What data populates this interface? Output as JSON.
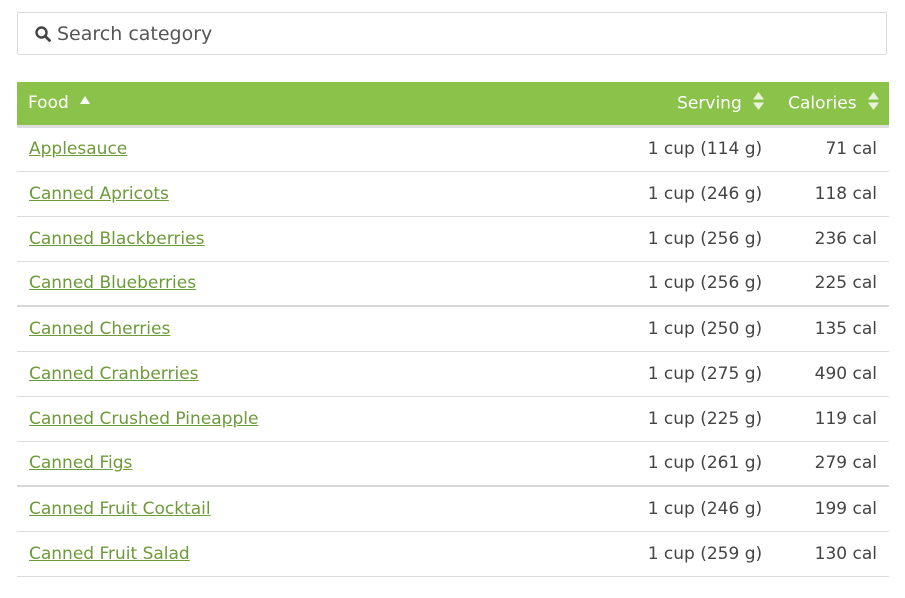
{
  "search": {
    "placeholder": "Search category",
    "value": "",
    "icon": "search-icon"
  },
  "table": {
    "headers": {
      "food": {
        "label": "Food",
        "sort": "ascending"
      },
      "serving": {
        "label": "Serving",
        "sort": "none"
      },
      "calories": {
        "label": "Calories",
        "sort": "none"
      }
    },
    "rows": [
      {
        "food": "Applesauce",
        "serving": "1 cup (114 g)",
        "calories": "71 cal"
      },
      {
        "food": "Canned Apricots",
        "serving": "1 cup (246 g)",
        "calories": "118 cal"
      },
      {
        "food": "Canned Blackberries",
        "serving": "1 cup (256 g)",
        "calories": "236 cal"
      },
      {
        "food": "Canned Blueberries",
        "serving": "1 cup (256 g)",
        "calories": "225 cal"
      },
      {
        "food": "Canned Cherries",
        "serving": "1 cup (250 g)",
        "calories": "135 cal"
      },
      {
        "food": "Canned Cranberries",
        "serving": "1 cup (275 g)",
        "calories": "490 cal"
      },
      {
        "food": "Canned Crushed Pineapple",
        "serving": "1 cup (225 g)",
        "calories": "119 cal"
      },
      {
        "food": "Canned Figs",
        "serving": "1 cup (261 g)",
        "calories": "279 cal"
      },
      {
        "food": "Canned Fruit Cocktail",
        "serving": "1 cup (246 g)",
        "calories": "199 cal"
      },
      {
        "food": "Canned Fruit Salad",
        "serving": "1 cup (259 g)",
        "calories": "130 cal"
      }
    ]
  },
  "colors": {
    "header_bg": "#8bc34a",
    "link": "#6d9a3a",
    "border": "#dddddd"
  }
}
